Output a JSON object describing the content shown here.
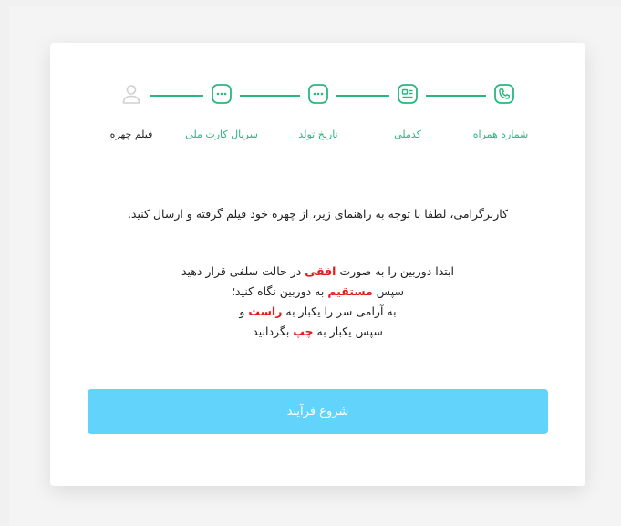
{
  "colors": {
    "accent_green": "#2ab67f",
    "inactive_gray": "#cfcfcf",
    "highlight_red": "#e21a1a",
    "button_blue": "#62d4fb"
  },
  "steps": [
    {
      "label": "شماره همراه",
      "icon": "phone-icon",
      "state": "complete"
    },
    {
      "label": "کدملی",
      "icon": "id-card-icon",
      "state": "complete"
    },
    {
      "label": "تاریخ تولد",
      "icon": "ellipsis-icon",
      "state": "complete"
    },
    {
      "label": "سریال کارت ملی",
      "icon": "ellipsis-icon",
      "state": "complete"
    },
    {
      "label": "فیلم چهره",
      "icon": "user-icon",
      "state": "current"
    }
  ],
  "instruction": "کاربرگرامی، لطفا با توجه به راهنمای زیر، از چهره خود فیلم گرفته و ارسال کنید.",
  "guide": {
    "line1_a": "ابتدا دوربین را به صورت ",
    "line1_highlight": "افقی",
    "line1_b": " در حالت سلفی قرار دهید",
    "line2_a": "سپس ",
    "line2_highlight": "مستقیم",
    "line2_b": " به دوربین نگاه کنید؛",
    "line3_a": "به آرامی سر را یکبار به ",
    "line3_highlight": "راست",
    "line3_b": " و",
    "line4_a": "سپس یکبار به ",
    "line4_highlight": "چپ",
    "line4_b": " بگردانید"
  },
  "start_button_label": "شروع فرآیند"
}
